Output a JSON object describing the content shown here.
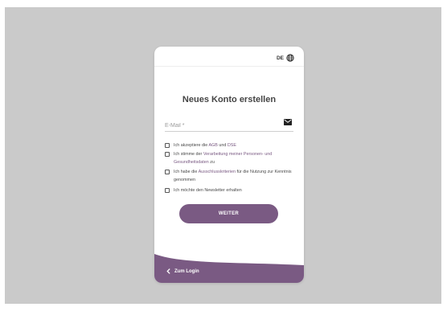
{
  "header": {
    "language_code": "DE",
    "language_icon": "globe-icon"
  },
  "form": {
    "title": "Neues Konto erstellen",
    "email_placeholder": "E-Mail *",
    "email_icon": "mail-icon",
    "checkboxes": [
      {
        "pre": "Ich akzeptiere die ",
        "link": "AGB",
        "mid": " und ",
        "link2": "DSE",
        "post": ""
      },
      {
        "pre": "Ich stimme der ",
        "link": "Verarbeitung meiner Personen- und Gesundheitsdaten",
        "post": " zu"
      },
      {
        "pre": "Ich habe die ",
        "link": "Ausschlusskriterien",
        "post": " für die Nutzung zur Kenntnis genommen"
      },
      {
        "pre": "Ich möchte den Newsletter erhalten"
      }
    ],
    "submit_label": "WEITER"
  },
  "footer": {
    "back_label": "Zum Login",
    "back_icon": "chevron-left-icon"
  },
  "colors": {
    "accent": "#7a5a83",
    "background": "#cacaca",
    "card": "#ffffff"
  }
}
